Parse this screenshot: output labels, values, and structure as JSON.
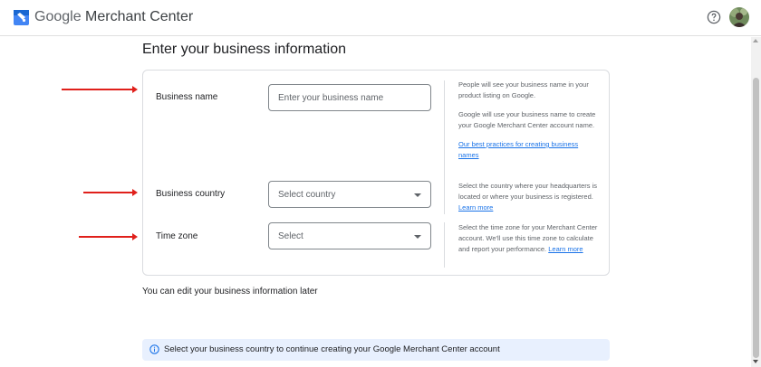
{
  "header": {
    "app_title_brand": "Google",
    "app_title_product": "Merchant Center",
    "help_icon": "help-circle-icon",
    "avatar": "user-avatar"
  },
  "page": {
    "title": "Enter your business information"
  },
  "form": {
    "business_name": {
      "label": "Business name",
      "placeholder": "Enter your business name",
      "value": "",
      "help_1": "People will see your business name in your product listing on Google.",
      "help_2": "Google will use your business name to create your Google Merchant Center account name.",
      "help_link": "Our best practices for creating business names"
    },
    "business_country": {
      "label": "Business country",
      "value": "Select country",
      "help": "Select the country where your headquarters is located or where your business is registered.",
      "help_link": "Learn more"
    },
    "time_zone": {
      "label": "Time zone",
      "value": "Select",
      "help": "Select the time zone for your Merchant Center account. We'll use this time zone to calculate and report your performance.",
      "help_link": "Learn more"
    }
  },
  "edit_note": "You can edit your business information later",
  "banner": {
    "icon": "info-icon",
    "text": "Select your business country to continue creating your Google Merchant Center account"
  },
  "colors": {
    "accent_link": "#1a73e8",
    "annotation_arrow": "#e0201b",
    "banner_bg": "#e8f0fe"
  }
}
